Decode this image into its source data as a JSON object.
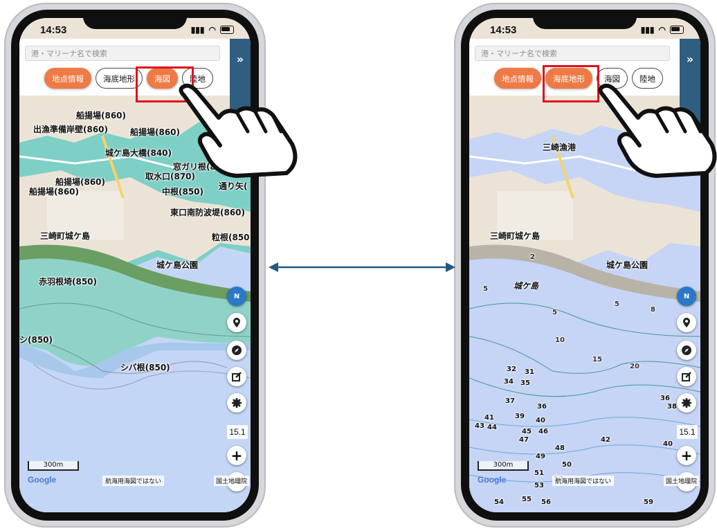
{
  "status": {
    "time": "14:53"
  },
  "search": {
    "placeholder": "港・マリーナ名で検索"
  },
  "layer_buttons": {
    "point_info": "地点情報",
    "seabed_terrain": "海底地形",
    "chart": "海図",
    "land": "陸地"
  },
  "side_toggle": "»",
  "left_screen": {
    "active_layers": [
      "地点情報",
      "海図"
    ],
    "labels": [
      "船揚場(860)",
      "出漁準備岸壁(860)",
      "船揚場(860)",
      "城ケ島大橋(840)",
      "窓ガリ根(8",
      "取水口(870)",
      "船揚場(860)",
      "船揚場(860)",
      "中根(850)",
      "通り矢(",
      "東口南防波堤(860)",
      "粒根(850",
      "三崎町城ケ島",
      "城ケ島公園",
      "赤羽根埼(850)",
      "シ(850)",
      "シバ根(850)"
    ]
  },
  "right_screen": {
    "active_layers": [
      "地点情報",
      "海底地形"
    ],
    "labels": [
      "三崎漁港",
      "三崎町城ケ島",
      "城ケ島公園",
      "城ケ島"
    ],
    "depths": [
      "2",
      "5",
      "5",
      "5",
      "8",
      "10",
      "15",
      "20",
      "20",
      "32",
      "31",
      "34",
      "35",
      "36",
      "37",
      "39",
      "40",
      "41",
      "43",
      "44",
      "45",
      "46",
      "47",
      "48",
      "49",
      "50",
      "51",
      "52",
      "53",
      "54",
      "55",
      "56",
      "59",
      "36",
      "38",
      "42",
      "40",
      "42"
    ]
  },
  "map_controls": {
    "north": "N",
    "zoom_level": "15.1",
    "zoom_in": "+",
    "zoom_out": "−"
  },
  "map_footer": {
    "scale": "300m",
    "google": "Google",
    "disclaimer": "航海用海図ではない",
    "attribution": "国土地理院"
  },
  "colors": {
    "accent": "#ee7a45",
    "highlight": "#e0101c",
    "arrow": "#1e5a84",
    "panel": "#2f5e80"
  }
}
